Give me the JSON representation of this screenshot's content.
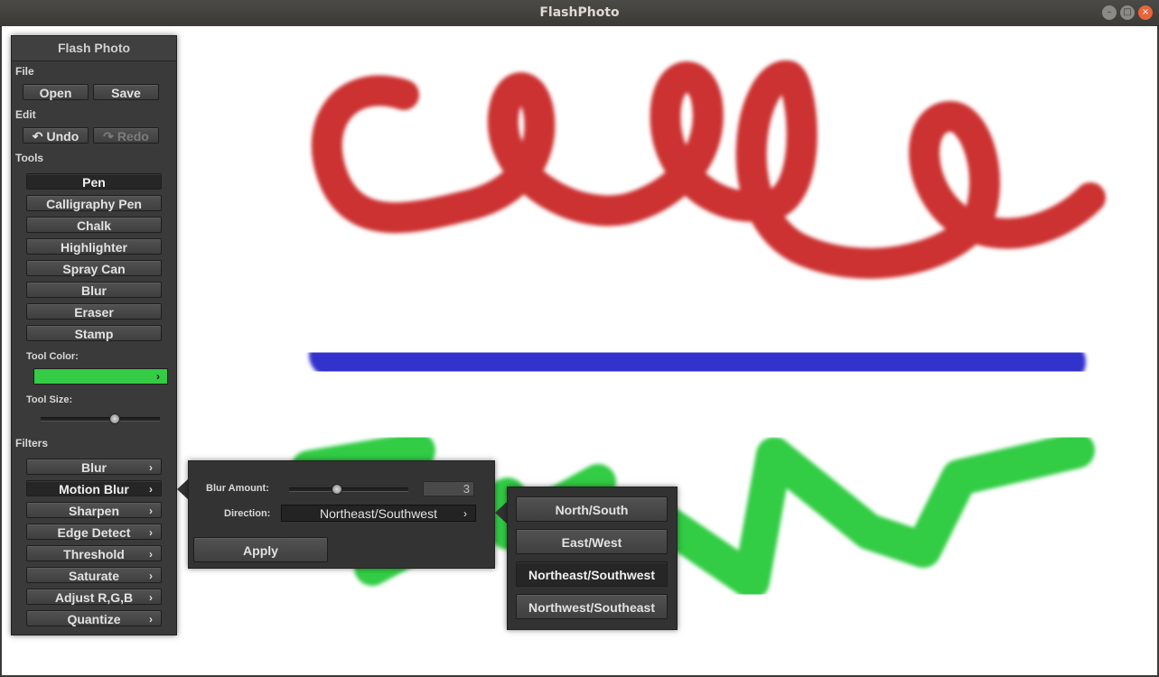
{
  "window": {
    "title": "FlashPhoto"
  },
  "panel": {
    "title": "Flash Photo",
    "file": {
      "heading": "File",
      "open": "Open",
      "save": "Save"
    },
    "edit": {
      "heading": "Edit",
      "undo": "Undo",
      "redo": "Redo"
    },
    "tools": {
      "heading": "Tools",
      "items": [
        "Pen",
        "Calligraphy Pen",
        "Chalk",
        "Highlighter",
        "Spray Can",
        "Blur",
        "Eraser",
        "Stamp"
      ],
      "selected": "Pen",
      "color_label": "Tool Color:",
      "color_value": "#33cc44",
      "size_label": "Tool Size:",
      "size_fraction": 0.62
    },
    "filters": {
      "heading": "Filters",
      "items": [
        "Blur",
        "Motion Blur",
        "Sharpen",
        "Edge Detect",
        "Threshold",
        "Saturate",
        "Adjust R,G,B",
        "Quantize"
      ],
      "selected": "Motion Blur"
    }
  },
  "motion_blur": {
    "amount_label": "Blur Amount:",
    "amount_value": "3",
    "amount_fraction": 0.4,
    "direction_label": "Direction:",
    "direction_value": "Northeast/Southwest",
    "apply": "Apply"
  },
  "direction_menu": {
    "options": [
      "North/South",
      "East/West",
      "Northeast/Southwest",
      "Northwest/Southeast"
    ],
    "selected": "Northeast/Southwest"
  },
  "canvas_colors": {
    "red": "#cc3333",
    "blue": "#3333cc",
    "green": "#33cc44"
  }
}
